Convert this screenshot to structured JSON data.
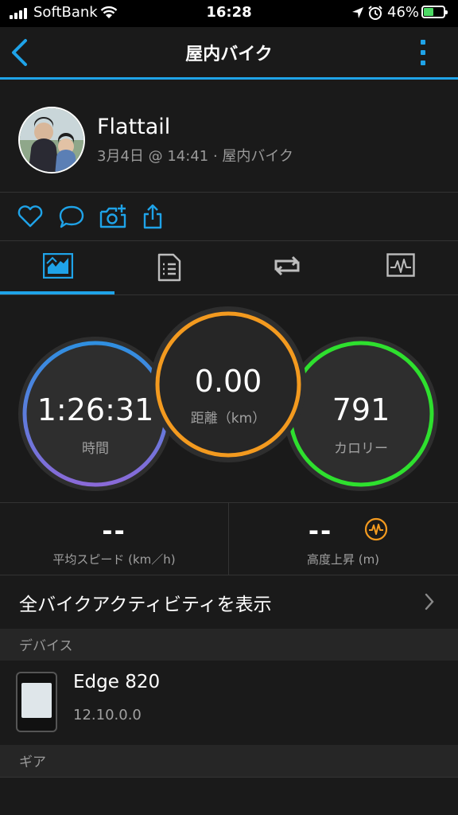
{
  "status_bar": {
    "carrier": "SoftBank",
    "time": "16:28",
    "battery_pct": "46%"
  },
  "nav": {
    "title": "屋内バイク"
  },
  "activity": {
    "user_name": "Flattail",
    "meta": "3月4日 @ 14:41 · 屋内バイク"
  },
  "colors": {
    "accent": "#1fa3e8",
    "time_ring_top": "#2f8fe0",
    "time_ring_bottom": "#8a6ad8",
    "distance_ring": "#f39a1f",
    "calorie_ring": "#2ee02e",
    "elevation_icon": "#f39a1f",
    "battery": "#4cd964"
  },
  "summary": {
    "time": {
      "value": "1:26:31",
      "label": "時間"
    },
    "distance": {
      "value": "0.00",
      "label": "距離（km）"
    },
    "calories": {
      "value": "791",
      "label": "カロリー"
    }
  },
  "stats": {
    "avg_speed": {
      "value": "--",
      "label": "平均スピード (km／h)"
    },
    "elevation_gain": {
      "value": "--",
      "label": "高度上昇 (m)"
    }
  },
  "links": {
    "show_all": "全バイクアクティビティを表示"
  },
  "sections": {
    "devices": "デバイス",
    "gear": "ギア"
  },
  "device": {
    "name": "Edge 820",
    "version": "12.10.0.0"
  },
  "icons": {
    "actions": [
      "heart-icon",
      "comment-icon",
      "add-photo-icon",
      "share-icon"
    ],
    "tabs": [
      "stats-chart-icon",
      "details-list-icon",
      "laps-loop-icon",
      "graph-icon"
    ]
  }
}
